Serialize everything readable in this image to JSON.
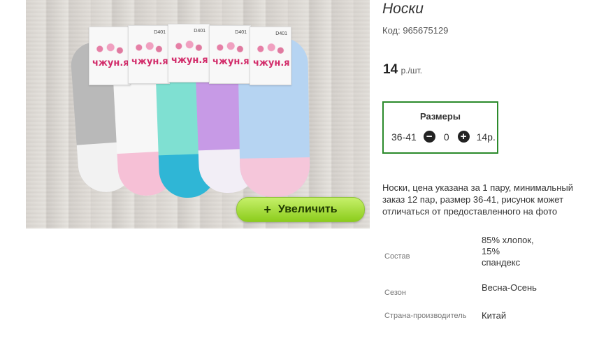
{
  "product": {
    "title": "Носки",
    "code_label": "Код:",
    "code_value": "965675129",
    "price_value": "14",
    "price_unit": "р./шт."
  },
  "photo": {
    "alt": "Носки",
    "brand_text": "чжун.я",
    "tag_code": "D401",
    "zoom_button_label": "Увеличить",
    "zoom_button_icon": "+"
  },
  "sizes": {
    "header": "Размеры",
    "size_label": "36-41",
    "minus_icon": "minus-circle-icon",
    "quantity": "0",
    "plus_icon": "plus-circle-icon",
    "price": "14р."
  },
  "description": "Носки, цена указана за 1 пару, минимальный заказ 12 пар, размер 36-41, рисунок может отличаться от предоставленного на фото",
  "properties": [
    {
      "label": "Состав",
      "value": "85% хлопок, 15% спандекс"
    },
    {
      "label": "Сезон",
      "value": "Весна-Осень"
    },
    {
      "label": "Страна-производитель",
      "value": "Китай"
    }
  ],
  "colors": {
    "sizes_border": "#2b8a2b",
    "zoom_button": "#a6dc3a",
    "brand_pink": "#d22c6a"
  }
}
